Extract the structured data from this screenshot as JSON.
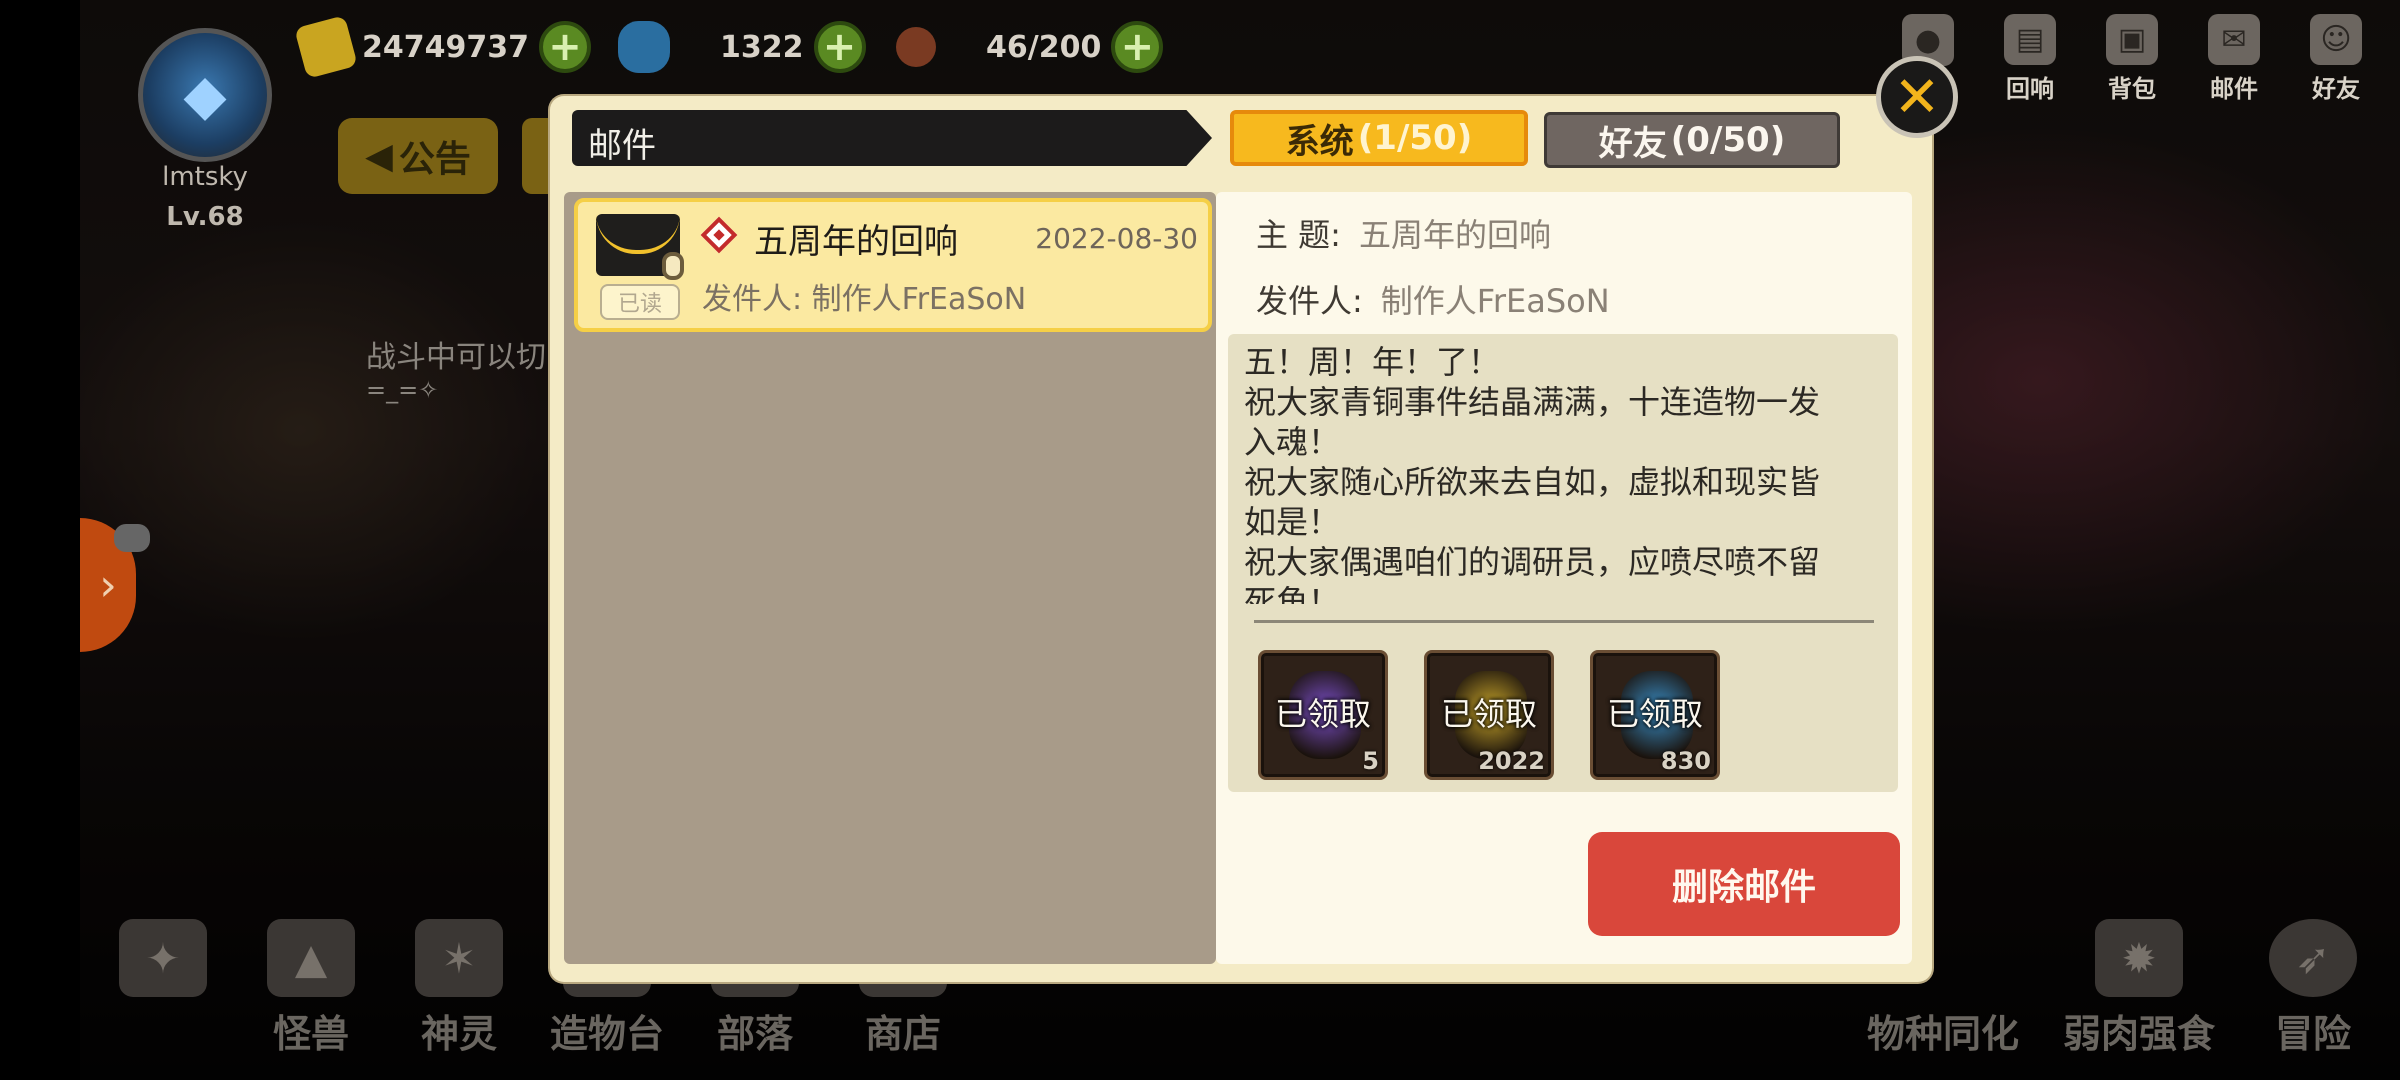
{
  "hud": {
    "gold": "24749737",
    "gems": "1322",
    "stamina": "46/200",
    "player_name": "lmtsky",
    "player_level": "Lv.68",
    "notice_label": "公告",
    "battle_hint": "战斗中可以切",
    "battle_hint_emote": "=_=✧",
    "top_icons": [
      "",
      "回响",
      "背包",
      "邮件",
      "好友"
    ]
  },
  "bottom_nav_left": [
    "",
    "怪兽",
    "神灵",
    "造物台",
    "部落",
    "商店"
  ],
  "bottom_nav_right": [
    "物种同化",
    "弱肉强食",
    "冒险"
  ],
  "dialog": {
    "title": "邮件",
    "tabs": {
      "system_label": "系统",
      "system_count": "(1/50)",
      "friends_label": "好友",
      "friends_count": "(0/50)"
    },
    "close_icon": "close-icon",
    "mail_list": [
      {
        "subject": "五周年的回响",
        "date": "2022-08-30",
        "sender": "发件人: 制作人FrEaSoN",
        "read_badge": "已读"
      }
    ],
    "detail": {
      "subject_label": "主  题:",
      "subject_value": "五周年的回响",
      "sender_label": "发件人:",
      "sender_value": "制作人FrEaSoN",
      "body": "五！周！年！了！\n祝大家青铜事件结晶满满，十连造物一发入魂！\n祝大家随心所欲来去自如，虚拟和现实皆如是！\n祝大家偶遇咱们的调研员，应喷尽喷不留死角！",
      "rewards": [
        {
          "status": "已领取",
          "quantity": "5",
          "color": "#7b4fc9"
        },
        {
          "status": "已领取",
          "quantity": "2022",
          "color": "#c9a62a"
        },
        {
          "status": "已领取",
          "quantity": "830",
          "color": "#3a8fc8"
        }
      ],
      "delete_label": "删除邮件"
    }
  },
  "colors": {
    "accent_tab": "#f7b91e",
    "delete_button": "#d9473b",
    "dialog_bg": "#f4ebc6"
  }
}
